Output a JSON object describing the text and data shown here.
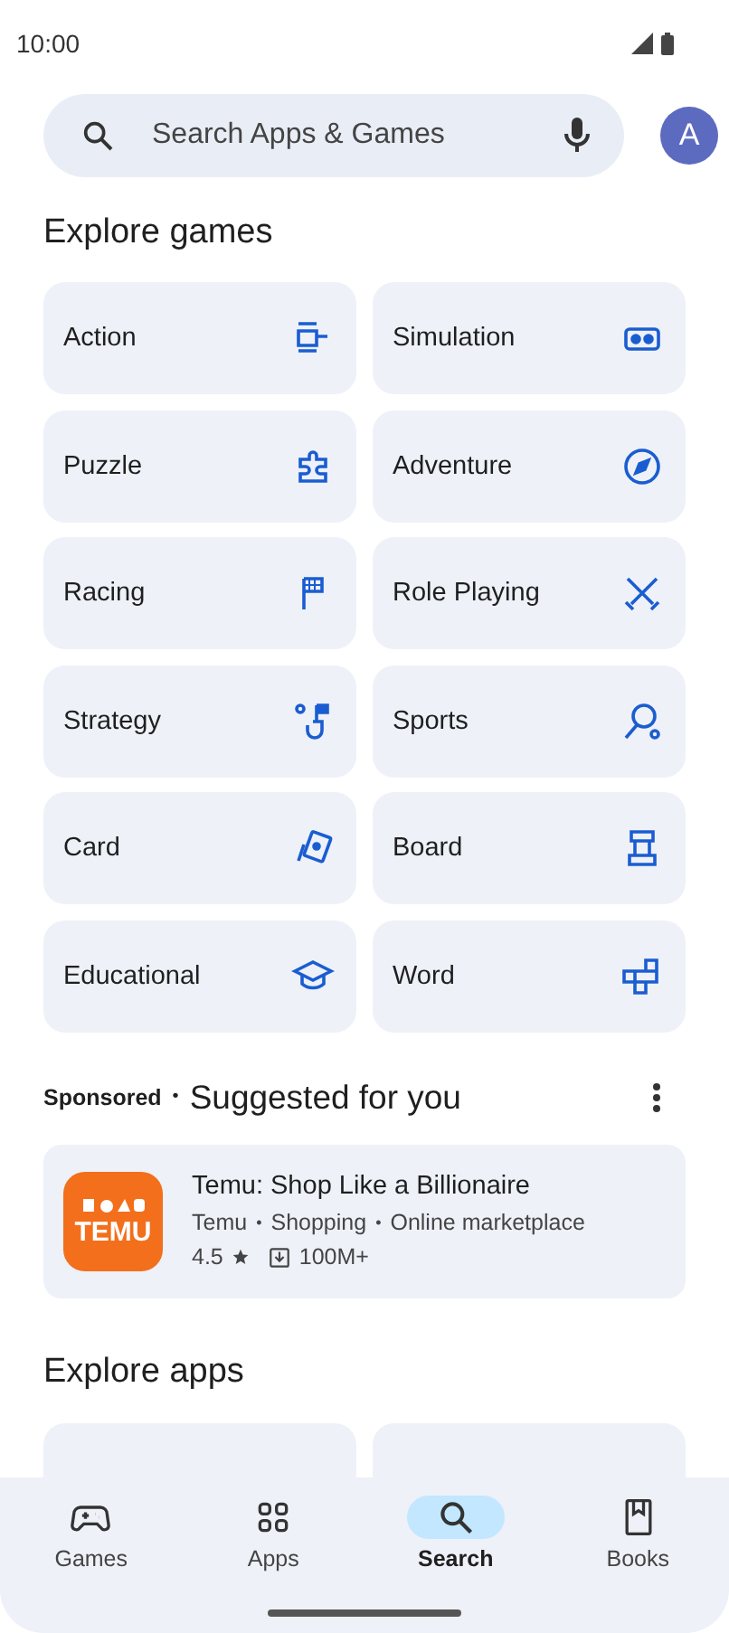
{
  "status_bar": {
    "time": "10:00"
  },
  "search": {
    "placeholder": "Search Apps & Games",
    "avatar_letter": "A"
  },
  "explore_games": {
    "title": "Explore games",
    "categories": [
      {
        "label": "Action"
      },
      {
        "label": "Simulation"
      },
      {
        "label": "Puzzle"
      },
      {
        "label": "Adventure"
      },
      {
        "label": "Racing"
      },
      {
        "label": "Role Playing"
      },
      {
        "label": "Strategy"
      },
      {
        "label": "Sports"
      },
      {
        "label": "Card"
      },
      {
        "label": "Board"
      },
      {
        "label": "Educational"
      },
      {
        "label": "Word"
      }
    ]
  },
  "suggested": {
    "sponsored": "Sponsored",
    "separator": "•",
    "title": "Suggested for you",
    "app": {
      "name": "Temu: Shop Like a Billionaire",
      "icon_text": "TEMU",
      "developer": "Temu",
      "category": "Shopping",
      "tag": "Online marketplace",
      "separator": "•",
      "rating": "4.5",
      "downloads": "100M+"
    }
  },
  "explore_apps": {
    "title": "Explore apps"
  },
  "bottom_nav": [
    {
      "label": "Games",
      "selected": false
    },
    {
      "label": "Apps",
      "selected": false
    },
    {
      "label": "Search",
      "selected": true
    },
    {
      "label": "Books",
      "selected": false
    }
  ]
}
